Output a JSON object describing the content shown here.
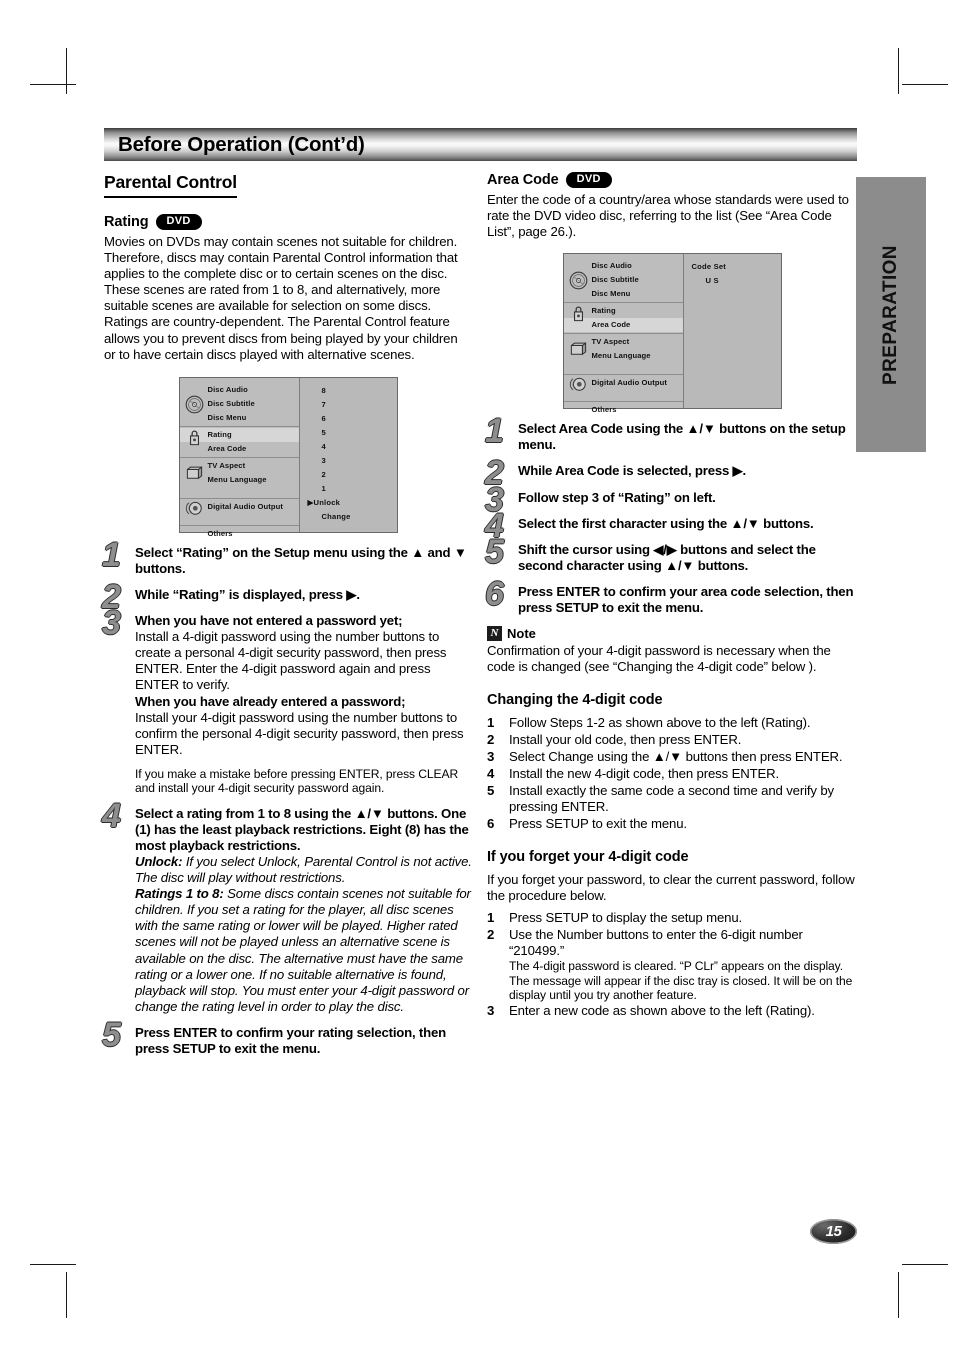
{
  "header": {
    "title": "Before Operation (Cont’d)"
  },
  "side_tab": {
    "label": "PREPARATION"
  },
  "page_number": "15",
  "left": {
    "section_title": "Parental Control",
    "rating": {
      "heading": "Rating",
      "badge": "DVD",
      "paragraph": "Movies on DVDs may contain scenes not suitable for children. Therefore, discs may contain Parental Control information that applies to the complete disc or to certain scenes on the disc. These scenes are rated from 1 to 8, and alternatively, more suitable scenes are available for selection on some discs. Ratings are country-dependent. The Parental Control feature allows you to prevent discs from being played by your children or to have certain discs played with alternative scenes."
    },
    "setup_menu": {
      "items": [
        "Disc Audio",
        "Disc Subtitle",
        "Disc Menu",
        "Rating",
        "Area Code",
        "TV Aspect",
        "Menu Language",
        "Digital Audio Output",
        "Others"
      ],
      "selected_item": "Rating",
      "values": [
        "8",
        "7",
        "6",
        "5",
        "4",
        "3",
        "2",
        "1",
        "▶Unlock",
        "Change"
      ],
      "icons": [
        "disc-icon",
        "lock-icon",
        "tv-icon",
        "speaker-icon"
      ]
    },
    "steps": [
      {
        "num": "1",
        "bold": "Select “Rating” on the Setup menu using the ▲ and ▼ buttons."
      },
      {
        "num": "2",
        "bold": "While “Rating” is displayed, press ▶."
      },
      {
        "num": "3",
        "bold": "When you have not entered a password yet;",
        "normal": "Install a 4-digit password using the number buttons to create a personal 4-digit security password, then press ENTER. Enter the 4-digit password again and press ENTER to verify.",
        "bold2": "When you have already entered a password;",
        "normal2": "Install your 4-digit password using the number buttons to confirm the personal 4-digit security password, then press ENTER.",
        "small": "If you make a mistake before pressing ENTER, press CLEAR and install your 4-digit security password again."
      },
      {
        "num": "4",
        "bold": "Select a rating from 1 to 8 using the ▲/▼ buttons. One (1) has the least playback restrictions. Eight (8) has the most playback restrictions.",
        "italic_label1": "Unlock:",
        "italic1": " If you select Unlock, Parental Control is not active. The disc will play without restrictions.",
        "italic_label2": "Ratings 1 to 8:",
        "italic2": " Some discs contain scenes not suitable for children. If you set a rating for the player, all disc scenes with the same rating or lower will be played. Higher rated scenes will not be played unless an alternative scene is available on the disc. The alternative must have the same rating or a lower one. If no suitable alternative is found, playback will stop. You must enter your 4-digit password or change the rating level in order to play the disc."
      },
      {
        "num": "5",
        "bold": "Press ENTER to confirm your rating selection, then press SETUP to exit the menu."
      }
    ]
  },
  "right": {
    "area_code": {
      "heading": "Area Code",
      "badge": "DVD",
      "paragraph": "Enter the code of a country/area whose standards were used to rate the DVD video disc, referring to the list (See “Area Code List”, page 26.)."
    },
    "setup_menu": {
      "items": [
        "Disc Audio",
        "Disc Subtitle",
        "Disc Menu",
        "Rating",
        "Area Code",
        "TV Aspect",
        "Menu Language",
        "Digital Audio Output",
        "Others"
      ],
      "selected_item": "Area Code",
      "values": [
        "Code Set",
        "U  S"
      ],
      "icons": [
        "disc-icon",
        "lock-icon",
        "tv-icon",
        "speaker-icon"
      ]
    },
    "steps": [
      {
        "num": "1",
        "bold": "Select Area Code using the ▲/▼ buttons on the setup menu."
      },
      {
        "num": "2",
        "bold": "While Area Code is selected, press ▶."
      },
      {
        "num": "3",
        "bold": "Follow step 3 of “Rating” on left."
      },
      {
        "num": "4",
        "bold": "Select the first character using the ▲/▼ buttons."
      },
      {
        "num": "5",
        "bold": "Shift the cursor using ◀/▶ buttons and select the second character using ▲/▼ buttons."
      },
      {
        "num": "6",
        "bold": "Press ENTER to confirm your area code selection, then press SETUP to exit the menu."
      }
    ],
    "note": {
      "icon_letter": "N",
      "label": "Note",
      "text": "Confirmation of your 4-digit password is necessary when the code is changed (see “Changing the 4-digit code” below )."
    },
    "changing_code": {
      "heading": "Changing the 4-digit code",
      "items": [
        {
          "n": "1",
          "text": "Follow Steps 1-2 as shown above to the left (Rating)."
        },
        {
          "n": "2",
          "text": "Install your old code, then press ENTER."
        },
        {
          "n": "3",
          "text": "Select Change using the ▲/▼ buttons then press ENTER."
        },
        {
          "n": "4",
          "text": "Install the new 4-digit code, then press ENTER."
        },
        {
          "n": "5",
          "text": "Install exactly the same code a second time and verify by pressing ENTER."
        },
        {
          "n": "6",
          "text": "Press SETUP to exit the menu."
        }
      ]
    },
    "forgot_code": {
      "heading": "If you forget your 4-digit code",
      "intro": "If you forget your password, to clear the current password, follow the procedure below.",
      "items": [
        {
          "n": "1",
          "text": "Press SETUP to display the setup menu."
        },
        {
          "n": "2",
          "text": "Use the Number buttons to enter the 6-digit number “210499.”",
          "sub": "The 4-digit password is cleared. “P CLr” appears on the display. The message will appear if the disc tray is closed. It will be on the display until you try another feature."
        },
        {
          "n": "3",
          "text": "Enter a new code as shown above to the left (Rating)."
        }
      ]
    }
  }
}
